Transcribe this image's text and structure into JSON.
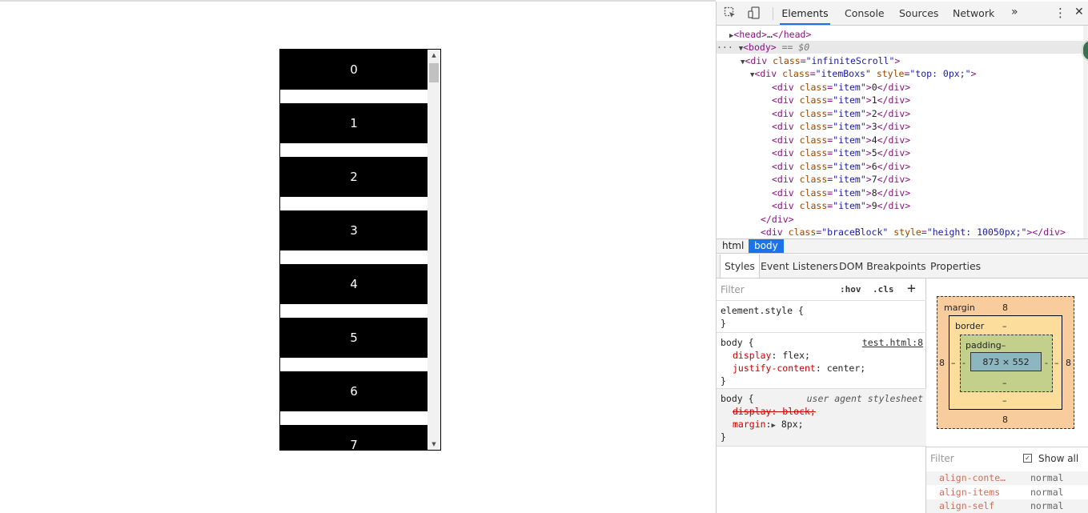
{
  "page": {
    "items": [
      "0",
      "1",
      "2",
      "3",
      "4",
      "5",
      "6",
      "7"
    ]
  },
  "devtools": {
    "tabs": [
      "Elements",
      "Console",
      "Sources",
      "Network"
    ],
    "more_label": "»",
    "dom": {
      "head": {
        "open": "<head>",
        "ellipsis": "…",
        "close": "</head>"
      },
      "body": {
        "open": "<body>",
        "marker": " == $0"
      },
      "infinite": {
        "tag": "<div",
        "attr": "class",
        "value": "\"infiniteScroll\"",
        "end": ">"
      },
      "itembox": {
        "tag": "<div",
        "attr1": "class",
        "value1": "\"itemBoxs\"",
        "attr2": "style",
        "value2": "\"top: 0px;\"",
        "end": ">"
      },
      "item_prefix": "<div",
      "item_attr": "class",
      "item_value": "\"item\"",
      "item_close": "</div>",
      "item_texts": [
        "0",
        "1",
        "2",
        "3",
        "4",
        "5",
        "6",
        "7",
        "8",
        "9"
      ],
      "div_close": "</div>",
      "brace": {
        "tag": "<div",
        "attr1": "class",
        "value1": "\"braceBlock\"",
        "attr2": "style",
        "value2": "\"height: 10050px;\"",
        "end": "></div>"
      }
    },
    "breadcrumbs": [
      "html",
      "body"
    ],
    "style_tabs": [
      "Styles",
      "Event Listeners",
      "DOM Breakpoints",
      "Properties"
    ],
    "styles": {
      "filter_placeholder": "Filter",
      "hov": ":hov",
      "cls": ".cls",
      "plus": "+",
      "element_style": "element.style {",
      "close_brace": "}",
      "rule1": {
        "selector": "body {",
        "source": "test.html:8",
        "decl1_prop": "display",
        "decl1_val": ": flex;",
        "decl2_prop": "justify-content",
        "decl2_val": ": center;"
      },
      "rule2": {
        "selector": "body {",
        "source": "user agent stylesheet",
        "decl1": "display: block;",
        "decl2_prop": "margin",
        "decl2_val": "8px;"
      }
    },
    "box_model": {
      "margin_label": "margin",
      "margin_top": "8",
      "margin_bottom": "8",
      "margin_left": "8",
      "margin_right": "8",
      "border_label": "border",
      "border_top": "–",
      "border_bottom": "–",
      "border_left": "–",
      "border_right": "–",
      "padding_label": "padding–",
      "padding_bottom": "–",
      "padding_left": "-",
      "padding_right": "-",
      "content": "873 × 552"
    },
    "computed": {
      "filter_placeholder": "Filter",
      "show_all": "Show all",
      "props": [
        {
          "name": "align-conte…",
          "value": "normal"
        },
        {
          "name": "align-items",
          "value": "normal"
        },
        {
          "name": "align-self",
          "value": "normal"
        }
      ]
    }
  }
}
